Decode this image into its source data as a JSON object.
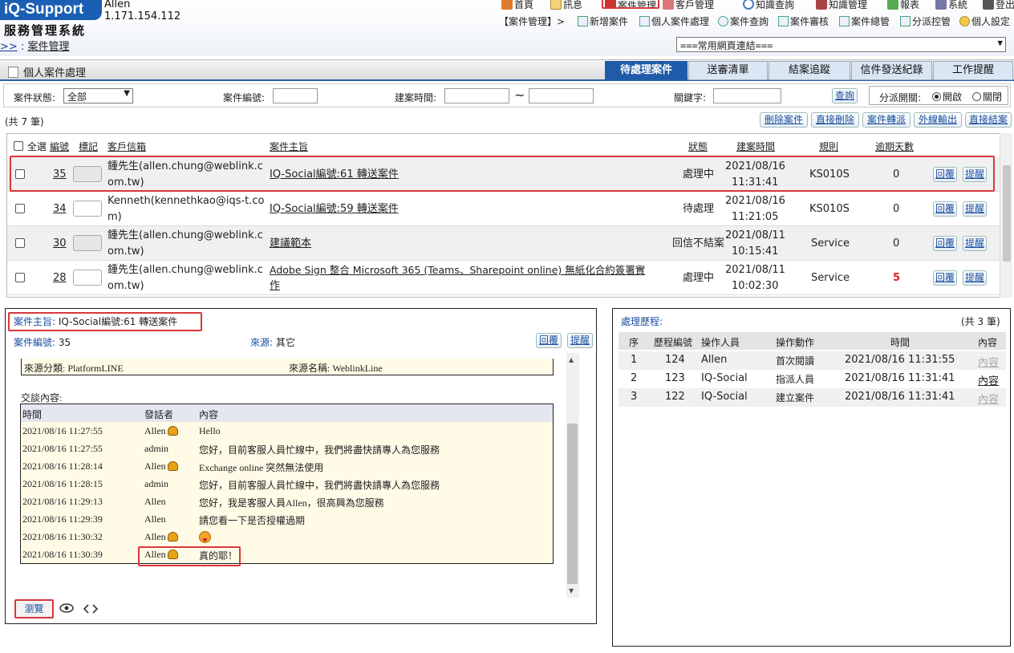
{
  "header": {
    "logo": "iQ-Support",
    "system_name": "服務管理系統",
    "user": "Allen",
    "ip": "1.171.154.112",
    "breadcrumb_prefix": ">>",
    "breadcrumb_current": "案件管理"
  },
  "top_nav": [
    {
      "label": "首頁",
      "icon": "home-icon"
    },
    {
      "label": "訊息",
      "icon": "mail-icon"
    },
    {
      "label": "案件管理",
      "icon": "case-icon"
    },
    {
      "label": "客戶管理",
      "icon": "customer-icon"
    },
    {
      "label": "知識查詢",
      "icon": "search-icon"
    },
    {
      "label": "知識管理",
      "icon": "book-icon"
    },
    {
      "label": "報表",
      "icon": "report-icon"
    },
    {
      "label": "系統",
      "icon": "system-icon"
    },
    {
      "label": "登出",
      "icon": "logout-icon"
    }
  ],
  "sub_nav": {
    "prefix": "【案件管理】>",
    "items": [
      "新增案件",
      "個人案件處理",
      "案件查詢",
      "案件審核",
      "案件總管",
      "分派控管",
      "個人設定"
    ]
  },
  "quick_links": "===常用網頁連結===",
  "page_title": "個人案件處理",
  "tabs": [
    "待處理案件",
    "送審清單",
    "結案追蹤",
    "信件發送紀錄",
    "工作提醒"
  ],
  "filter": {
    "status_label": "案件狀態:",
    "status_value": "全部",
    "case_no_label": "案件編號:",
    "created_label": "建案時間:",
    "tilde": "~",
    "keyword_label": "關鍵字:",
    "search_button": "查詢",
    "dispatch_label": "分派開關:",
    "open_label": "開啟",
    "close_label": "關閉"
  },
  "list": {
    "count_text": "(共 7 筆)",
    "actions": [
      "刪除案件",
      "直接刪除",
      "案件轉派",
      "外線輸出",
      "直接結案"
    ],
    "headers": {
      "select_all": "全選",
      "no": "編號",
      "mark": "標記",
      "customer": "客戶信箱",
      "subject": "案件主旨",
      "status": "狀態",
      "created": "建案時間",
      "rule": "規則",
      "overdue": "逾期天數"
    },
    "rows": [
      {
        "no": "35",
        "customer_l1": "鍾先生(allen.chung@weblink.c",
        "customer_l2": "om.tw)",
        "subject": "IQ-Social編號:61 轉送案件",
        "subject_l2": "",
        "status": "處理中",
        "date": "2021/08/16",
        "time": "11:31:41",
        "rule": "KS010S",
        "overdue": "0"
      },
      {
        "no": "34",
        "customer_l1": "Kenneth(kennethkao@iqs-t.co",
        "customer_l2": "m)",
        "subject": "IQ-Social編號:59 轉送案件",
        "subject_l2": "",
        "status": "待處理",
        "date": "2021/08/16",
        "time": "11:21:05",
        "rule": "KS010S",
        "overdue": "0"
      },
      {
        "no": "30",
        "customer_l1": "鍾先生(allen.chung@weblink.c",
        "customer_l2": "om.tw)",
        "subject": "建議範本",
        "subject_l2": "",
        "status": "回信不結案",
        "date": "2021/08/11",
        "time": "10:15:41",
        "rule": "Service",
        "overdue": "0"
      },
      {
        "no": "28",
        "customer_l1": "鍾先生(allen.chung@weblink.c",
        "customer_l2": "om.tw)",
        "subject": "Adobe Sign 整合 Microsoft 365 (Teams、Sharepoint online) 無紙化合約簽署實",
        "subject_l2": "作",
        "status": "處理中",
        "date": "2021/08/11",
        "time": "10:02:30",
        "rule": "Service",
        "overdue": "5"
      }
    ],
    "reply_button": "回覆",
    "remind_button": "提醒"
  },
  "detail": {
    "subject_label": "案件主旨:",
    "subject_value": "IQ-Social編號:61 轉送案件",
    "case_no_label": "案件編號:",
    "case_no_value": "35",
    "source_label": "來源:",
    "source_value": "其它",
    "reply_button": "回覆",
    "remind_button": "提醒",
    "source_category": "來源分類: PlatformLINE",
    "source_name": "來源名稱: WeblinkLine",
    "conversation_label": "交談內容:",
    "chat_headers": {
      "time": "時間",
      "speaker": "發話者",
      "content": "內容"
    },
    "chat": [
      {
        "time": "2021/08/16 11:27:55",
        "speaker": "Allen",
        "content": "Hello",
        "avatar": true
      },
      {
        "time": "2021/08/16 11:27:55",
        "speaker": "admin",
        "content": "您好，目前客服人員忙線中，我們將盡快請專人為您服務",
        "avatar": false
      },
      {
        "time": "2021/08/16 11:28:14",
        "speaker": "Allen",
        "content": "Exchange online 突然無法使用",
        "avatar": true
      },
      {
        "time": "2021/08/16 11:28:15",
        "speaker": "admin",
        "content": "您好，目前客服人員忙線中，我們將盡快請專人為您服務",
        "avatar": false
      },
      {
        "time": "2021/08/16 11:29:13",
        "speaker": "Allen",
        "content": "您好，我是客服人員Allen，很高興為您服務",
        "avatar": false
      },
      {
        "time": "2021/08/16 11:29:39",
        "speaker": "Allen",
        "content": "請您看一下是否授權過期",
        "avatar": false
      },
      {
        "time": "2021/08/16 11:30:32",
        "speaker": "Allen",
        "content": "",
        "avatar": true
      },
      {
        "time": "2021/08/16 11:30:39",
        "speaker": "Allen",
        "content": "真的耶！",
        "avatar": true
      }
    ],
    "browse_button": "瀏覽"
  },
  "history": {
    "title": "處理歷程:",
    "count_text": "(共 3 筆)",
    "headers": {
      "seq": "序",
      "record_no": "歷程編號",
      "operator": "操作人員",
      "action": "操作動作",
      "time": "時間",
      "content": "內容"
    },
    "rows": [
      {
        "seq": "1",
        "record_no": "124",
        "operator": "Allen",
        "action": "首次閱讀",
        "time": "2021/08/16 11:31:55",
        "content": "內容"
      },
      {
        "seq": "2",
        "record_no": "123",
        "operator": "IQ-Social",
        "action": "指派人員",
        "time": "2021/08/16 11:31:41",
        "content": "內容"
      },
      {
        "seq": "3",
        "record_no": "122",
        "operator": "IQ-Social",
        "action": "建立案件",
        "time": "2021/08/16 11:31:41",
        "content": "內容"
      }
    ]
  },
  "colors": {
    "accent": "#1f5ba8",
    "highlight": "#d9383a",
    "chat_bg": "#fffbe6"
  }
}
